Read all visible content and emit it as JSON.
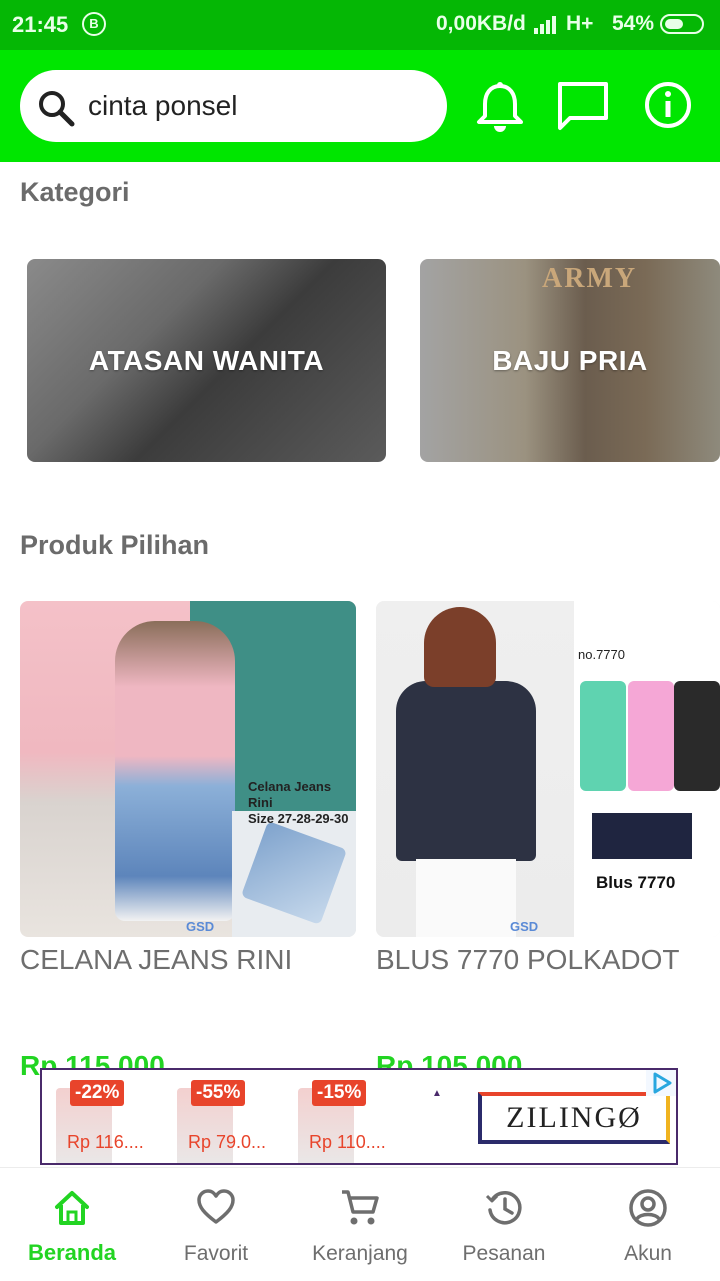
{
  "status_bar": {
    "time": "21:45",
    "notification_badge": "B",
    "network_speed": "0,00KB/d",
    "network_type": "H+",
    "battery_percent": "54%",
    "battery_level": 0.54
  },
  "header": {
    "search": {
      "value": "cinta ponsel"
    },
    "icons": [
      "bell-icon",
      "chat-icon",
      "info-icon"
    ],
    "background_color": "#00e600"
  },
  "kategori": {
    "title": "Kategori",
    "items": [
      {
        "label": "ATASAN WANITA"
      },
      {
        "label": "BAJU PRIA",
        "image_text": "ARMY"
      }
    ]
  },
  "produk_pilihan": {
    "title": "Produk Pilihan",
    "items": [
      {
        "name": "CELANA JEANS RINI",
        "price": "Rp 115.000",
        "image_caption_1": "Celana Jeans Rini",
        "image_caption_2": "Size 27-28-29-30",
        "watermark": "GSD"
      },
      {
        "name": "BLUS 7770 POLKADOT",
        "price": "Rp 105.000",
        "image_no": "no.7770",
        "image_caption": "Blus 7770",
        "watermark": "GSD"
      }
    ],
    "price_color": "#22d422"
  },
  "ad": {
    "deals": [
      {
        "discount": "-22%",
        "price": "Rp 116...."
      },
      {
        "discount": "-55%",
        "price": "Rp 79.0..."
      },
      {
        "discount": "-15%",
        "price": "Rp 110...."
      }
    ],
    "brand": "ZILINGØ",
    "adchoices_icon": "adchoices-icon",
    "accent_color": "#e8442b"
  },
  "bottom_nav": {
    "active": "Beranda",
    "active_color": "#22d422",
    "items": [
      {
        "label": "Beranda",
        "icon": "home-icon"
      },
      {
        "label": "Favorit",
        "icon": "heart-icon"
      },
      {
        "label": "Keranjang",
        "icon": "cart-icon"
      },
      {
        "label": "Pesanan",
        "icon": "history-icon"
      },
      {
        "label": "Akun",
        "icon": "account-icon"
      }
    ]
  }
}
